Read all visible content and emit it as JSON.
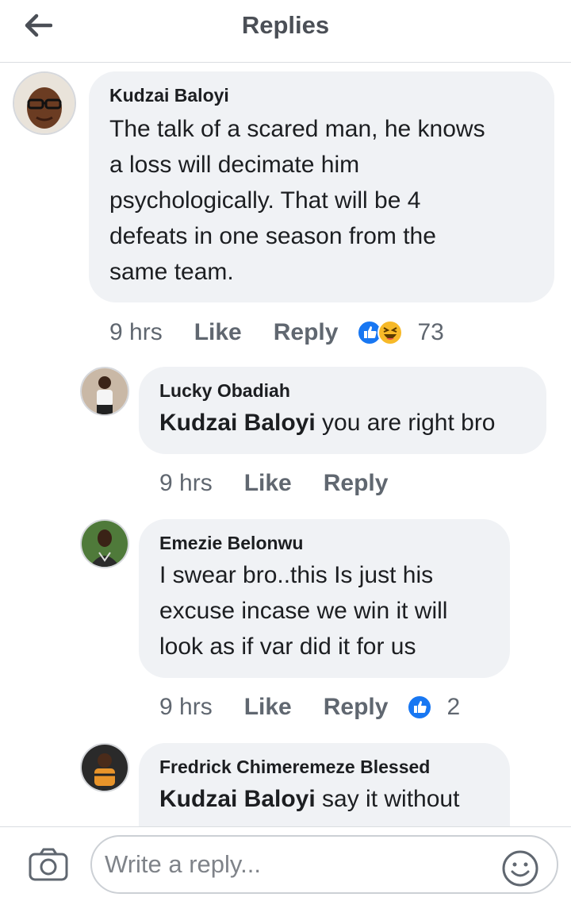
{
  "header": {
    "title": "Replies",
    "back_icon": "arrow-left-icon"
  },
  "comment_main": {
    "author": "Kudzai Baloyi",
    "lines": [
      "The talk of a scared man, he knows",
      "a loss will decimate him",
      "psychologically. That will be 4",
      "defeats in one season from the",
      "same team."
    ],
    "time": "9 hrs",
    "like_label": "Like",
    "reply_label": "Reply",
    "reaction_icons": [
      "like-reaction-icon",
      "haha-reaction-icon"
    ],
    "reaction_count": "73"
  },
  "reply_1": {
    "author": "Lucky Obadiah",
    "mention": "Kudzai Baloyi",
    "text": " you are right bro",
    "time": "9 hrs",
    "like_label": "Like",
    "reply_label": "Reply"
  },
  "reply_2": {
    "author": "Emezie Belonwu",
    "lines": [
      "I swear bro..this Is just his",
      "excuse incase we win it will",
      "look as if var did it for us"
    ],
    "time": "9 hrs",
    "like_label": "Like",
    "reply_label": "Reply",
    "reaction_icons": [
      "like-reaction-icon"
    ],
    "reaction_count": "2"
  },
  "reply_3": {
    "author": "Fredrick Chimeremeze Blessed",
    "mention": "Kudzai Baloyi",
    "text": " say it without"
  },
  "footer": {
    "placeholder": "Write a reply...",
    "camera_icon": "camera-icon",
    "emoji_icon": "smiley-icon"
  },
  "colors": {
    "bubble": "#f0f2f5",
    "meta_text": "#606770",
    "like_blue": "#1877f2",
    "haha_yellow": "#f7b928"
  }
}
